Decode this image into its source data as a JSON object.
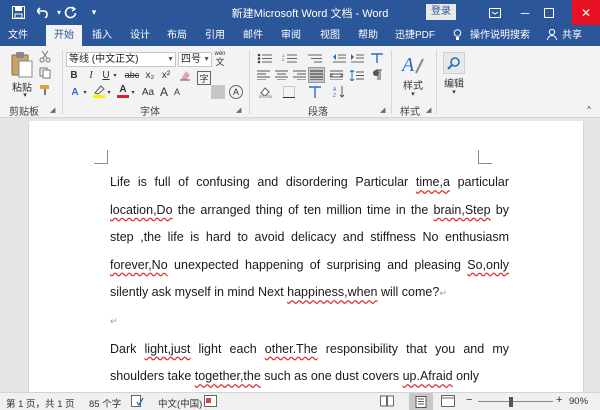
{
  "titlebar": {
    "title": "新建Microsoft Word 文档  -  Word",
    "login": "登录"
  },
  "tabs": [
    "文件",
    "开始",
    "插入",
    "设计",
    "布局",
    "引用",
    "邮件",
    "审阅",
    "视图",
    "帮助",
    "迅捷PDF",
    "操作说明搜索",
    "共享"
  ],
  "ribbon": {
    "clipboard": {
      "paste": "粘贴",
      "group": "剪贴板"
    },
    "font": {
      "name": "等线 (中文正文)",
      "size": "四号",
      "wen": "wén",
      "wen_glyph": "文",
      "group": "字体",
      "buttons": [
        "B",
        "I",
        "U",
        "abc",
        "x₂",
        "x²",
        "A",
        "A",
        "A",
        "Aa",
        "A",
        "A",
        "字",
        "A"
      ]
    },
    "paragraph": {
      "group": "段落"
    },
    "styles": {
      "label": "样式",
      "group": "样式"
    },
    "editing": {
      "label": "编辑"
    }
  },
  "document": {
    "paragraphs": [
      [
        {
          "t": "Life is full of confusing and disordering Particular "
        },
        {
          "t": "time,a",
          "sq": true
        },
        {
          "t": " particular "
        },
        {
          "t": "location,Do",
          "sq": true
        },
        {
          "t": " the arranged thing of ten million time in the "
        },
        {
          "t": "brain,Step",
          "sq": true
        },
        {
          "t": " by step ,the life is hard to avoid delicacy and stiffness No enthusiasm "
        },
        {
          "t": "forever,No",
          "sq": true
        },
        {
          "t": " unexpected happening of surprising and pleasing "
        },
        {
          "t": "So,only",
          "sq": true
        },
        {
          "t": " silently ask myself in mind Next "
        },
        {
          "t": "happiness,when",
          "sq": true
        },
        {
          "t": " will come?"
        }
      ],
      [],
      [
        {
          "t": "Dark "
        },
        {
          "t": "light,just",
          "sq": true
        },
        {
          "t": " light each "
        },
        {
          "t": "other.The",
          "sq": true
        },
        {
          "t": " responsibility that you and my shoulders take "
        },
        {
          "t": "together,the",
          "sq": true
        },
        {
          "t": " such as one dust covers "
        },
        {
          "t": "up.Afraid",
          "sq": true
        },
        {
          "t": " only"
        }
      ]
    ]
  },
  "status": {
    "page": "第 1 页，共 1 页",
    "words": "85 个字",
    "language": "中文(中国)",
    "zoom": "90%",
    "zoom_minus": "−",
    "zoom_plus": "+"
  },
  "icons": {
    "save": "💾",
    "undo": "↶",
    "redo": "↻",
    "customize": "▾",
    "restore": "🗗",
    "minimize": "─",
    "maximize": "☐",
    "close": "✕",
    "search": "💡",
    "user": "👤"
  },
  "colors": {
    "brand": "#2b579a",
    "close": "#e81123",
    "highlight": "#fff000",
    "fontcolor": "#d9222a",
    "squiggle": "#d33"
  }
}
